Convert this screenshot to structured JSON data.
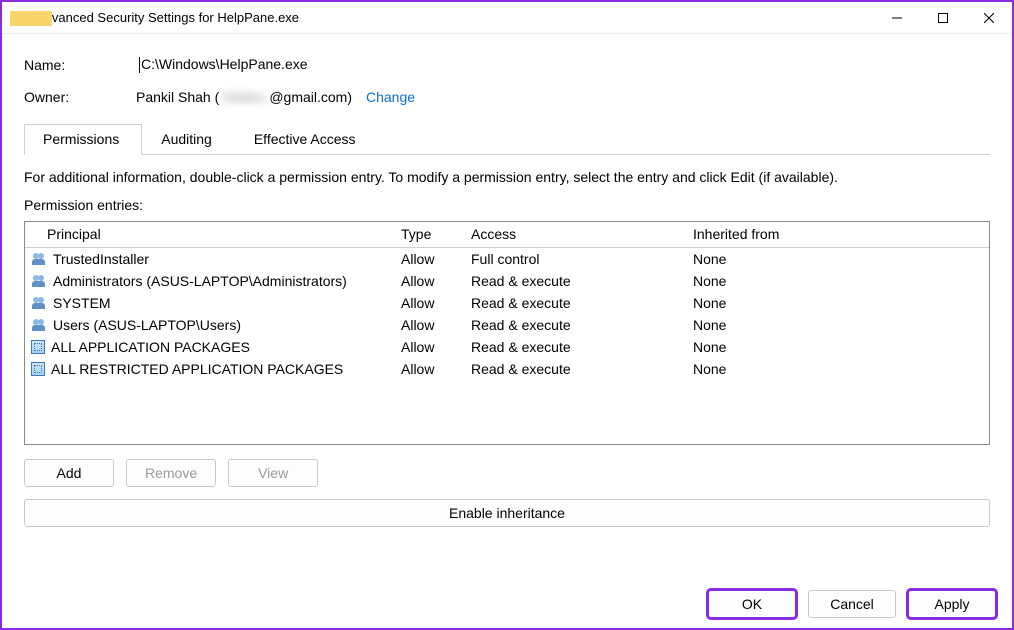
{
  "window": {
    "title": "Advanced Security Settings for HelpPane.exe"
  },
  "header": {
    "nameLabel": "Name:",
    "path": "C:\\Windows\\HelpPane.exe",
    "ownerLabel": "Owner:",
    "ownerPrefix": "Pankil Shah (",
    "ownerHidden": "hidden",
    "ownerSuffix": "@gmail.com)",
    "changeLink": "Change"
  },
  "tabs": {
    "permissions": "Permissions",
    "auditing": "Auditing",
    "effective": "Effective Access"
  },
  "instruction": "For additional information, double-click a permission entry. To modify a permission entry, select the entry and click Edit (if available).",
  "permLabel": "Permission entries:",
  "columns": {
    "principal": "Principal",
    "type": "Type",
    "access": "Access",
    "inherited": "Inherited from"
  },
  "rows": [
    {
      "icon": "users",
      "principal": "TrustedInstaller",
      "type": "Allow",
      "access": "Full control",
      "inherited": "None"
    },
    {
      "icon": "users",
      "principal": "Administrators (ASUS-LAPTOP\\Administrators)",
      "type": "Allow",
      "access": "Read & execute",
      "inherited": "None"
    },
    {
      "icon": "users",
      "principal": "SYSTEM",
      "type": "Allow",
      "access": "Read & execute",
      "inherited": "None"
    },
    {
      "icon": "users",
      "principal": "Users (ASUS-LAPTOP\\Users)",
      "type": "Allow",
      "access": "Read & execute",
      "inherited": "None"
    },
    {
      "icon": "pkg",
      "principal": "ALL APPLICATION PACKAGES",
      "type": "Allow",
      "access": "Read & execute",
      "inherited": "None"
    },
    {
      "icon": "pkg",
      "principal": "ALL RESTRICTED APPLICATION PACKAGES",
      "type": "Allow",
      "access": "Read & execute",
      "inherited": "None"
    }
  ],
  "buttons": {
    "add": "Add",
    "remove": "Remove",
    "view": "View",
    "enable": "Enable inheritance",
    "ok": "OK",
    "cancel": "Cancel",
    "apply": "Apply"
  }
}
